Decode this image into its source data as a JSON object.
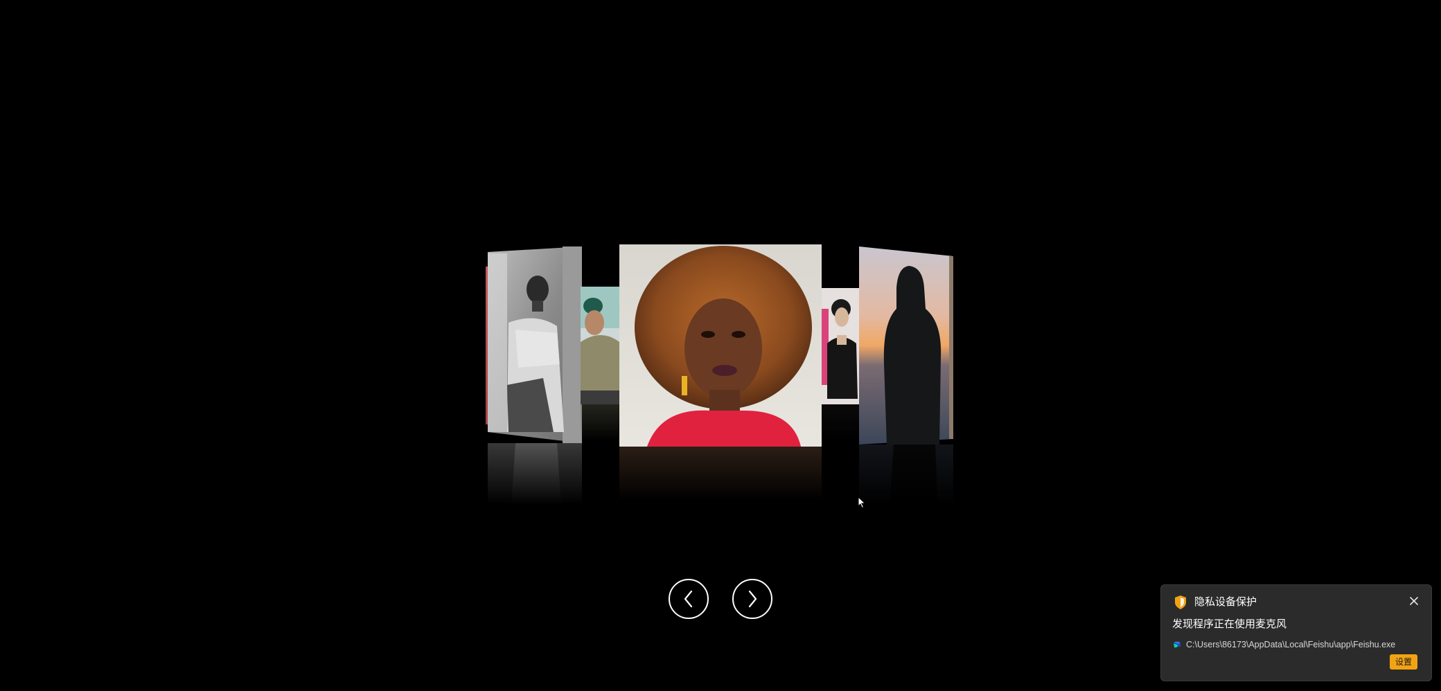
{
  "carousel": {
    "images": [
      {
        "subject": "woman in red dress, curly hair"
      },
      {
        "subject": "man in beanie crouching"
      },
      {
        "subject": "woman in black outfit"
      },
      {
        "subject": "hooded figure at sunset over city"
      },
      {
        "subject": "man leaning on rocks, black and white"
      }
    ]
  },
  "nav": {
    "prev_icon": "chevron-left-icon",
    "next_icon": "chevron-right-icon"
  },
  "toast": {
    "title": "隐私设备保护",
    "message": "发现程序正在使用麦克风",
    "path": "C:\\Users\\86173\\AppData\\Local\\Feishu\\app\\Feishu.exe",
    "settings_label": "设置",
    "icons": {
      "shield": "shield-icon",
      "app": "feishu-app-icon",
      "close": "close-icon"
    }
  },
  "colors": {
    "background": "#000000",
    "toast_bg": "#2b2b2b",
    "accent": "#f2a313"
  }
}
